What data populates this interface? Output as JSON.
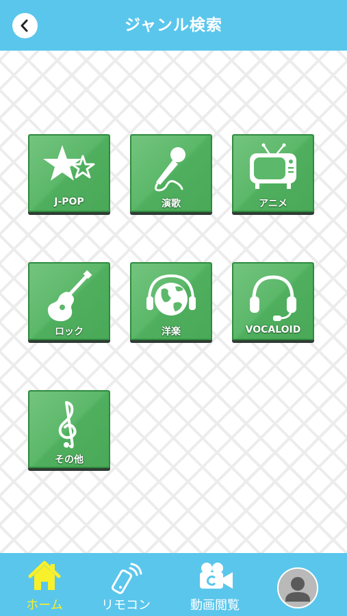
{
  "header": {
    "title": "ジャンル検索",
    "back_icon": "chevron-left-icon"
  },
  "genres": [
    {
      "label": "J-POP",
      "icon": "star-icon"
    },
    {
      "label": "演歌",
      "icon": "microphone-icon"
    },
    {
      "label": "アニメ",
      "icon": "tv-icon"
    },
    {
      "label": "ロック",
      "icon": "guitar-icon"
    },
    {
      "label": "洋楽",
      "icon": "globe-headphones-icon"
    },
    {
      "label": "VOCALOID",
      "icon": "headset-icon"
    },
    {
      "label": "その他",
      "icon": "treble-clef-icon"
    }
  ],
  "bottom_nav": {
    "items": [
      {
        "label": "ホーム",
        "icon": "home-icon",
        "active": true
      },
      {
        "label": "リモコン",
        "icon": "remote-icon",
        "active": false
      },
      {
        "label": "動画閲覧",
        "icon": "video-camera-icon",
        "active": false
      }
    ],
    "profile_icon": "user-avatar-icon"
  },
  "colors": {
    "header_bg": "#5ac6ec",
    "tile_green": "#5cb86a",
    "active_nav": "#f8f02a"
  }
}
